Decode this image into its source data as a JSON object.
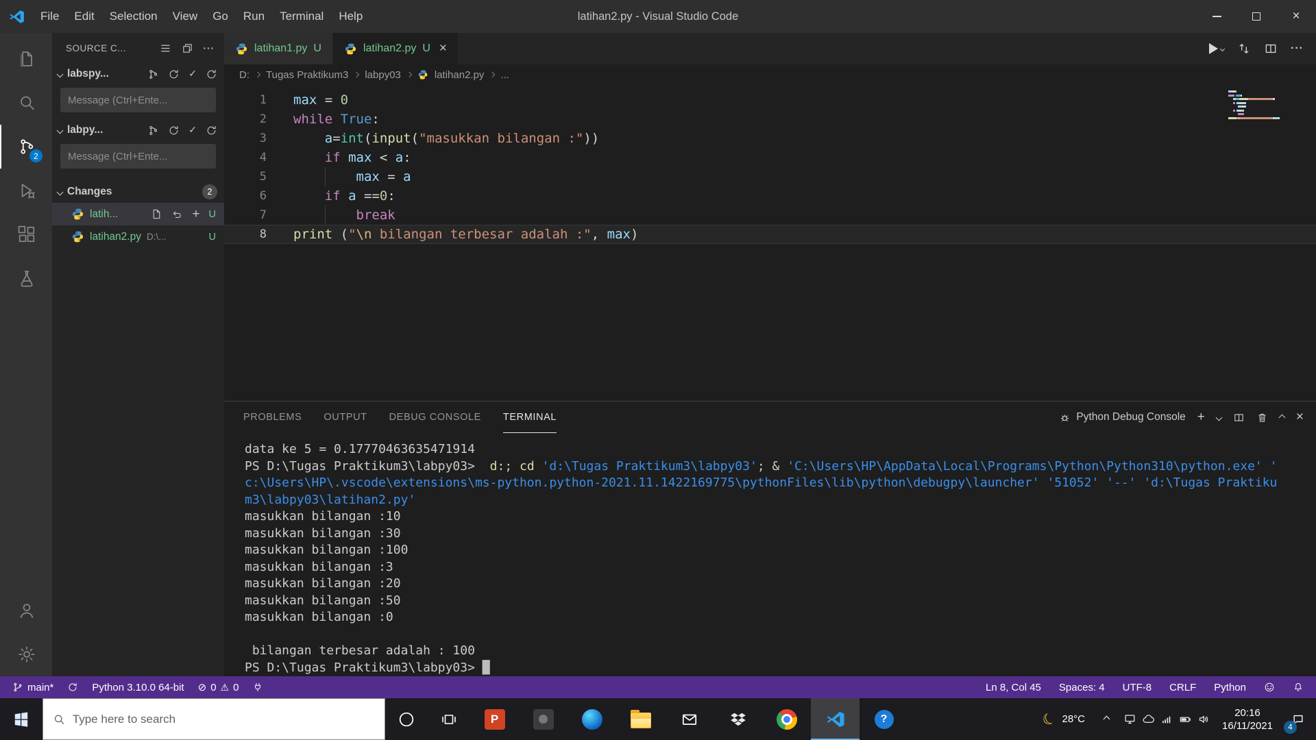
{
  "colors": {
    "accent": "#007acc",
    "statusbar_bg": "#532d8c",
    "badge_blue": "#007acc",
    "untracked_green": "#73c991",
    "tok_var": "#9cdcfe",
    "tok_kw": "#c586c0",
    "tok_const": "#569cd6",
    "tok_num": "#b5cea8",
    "tok_str": "#ce9178",
    "tok_esc": "#d7ba7d",
    "tok_fn": "#dcdcaa",
    "tok_cls": "#4ec9b0",
    "tok_fg": "#d4d4d4",
    "term_fg": "#cccccc",
    "term_cmd": "#dcdcaa",
    "term_str": "#3b8eea"
  },
  "titlebar": {
    "title": "latihan2.py - Visual Studio Code",
    "menus": [
      "File",
      "Edit",
      "Selection",
      "View",
      "Go",
      "Run",
      "Terminal",
      "Help"
    ]
  },
  "activity_bar": {
    "scm_badge": "2"
  },
  "sidebar": {
    "title": "SOURCE C...",
    "repos": [
      {
        "name": "labspy...",
        "message_placeholder": "Message (Ctrl+Ente..."
      },
      {
        "name": "labpy...",
        "message_placeholder": "Message (Ctrl+Ente..."
      }
    ],
    "changes_label": "Changes",
    "changes_badge": "2",
    "files": [
      {
        "name": "latih...",
        "status": "U"
      },
      {
        "name": "latihan2.py",
        "path": "D:\\...",
        "status": "U"
      }
    ]
  },
  "tabs": [
    {
      "label": "latihan1.py",
      "badge": "U"
    },
    {
      "label": "latihan2.py",
      "badge": "U"
    }
  ],
  "breadcrumb": [
    "D:",
    "Tugas Praktikum3",
    "labpy03",
    "latihan2.py",
    "..."
  ],
  "editor": {
    "lines": [
      {
        "num": "1",
        "tokens": [
          [
            "max",
            "var"
          ],
          [
            " = ",
            "fg"
          ],
          [
            "0",
            "num"
          ]
        ]
      },
      {
        "num": "2",
        "tokens": [
          [
            "while",
            "kw"
          ],
          [
            " ",
            "fg"
          ],
          [
            "True",
            "const"
          ],
          [
            ":",
            "fg"
          ]
        ]
      },
      {
        "num": "3",
        "tokens": [
          [
            "    ",
            "fg"
          ],
          [
            "a",
            "var"
          ],
          [
            "=",
            "fg"
          ],
          [
            "int",
            "cls"
          ],
          [
            "(",
            "fg"
          ],
          [
            "input",
            "fn"
          ],
          [
            "(",
            "fg"
          ],
          [
            "\"masukkan bilangan :\"",
            "str"
          ],
          [
            "))",
            "fg"
          ]
        ]
      },
      {
        "num": "4",
        "tokens": [
          [
            "    ",
            "fg"
          ],
          [
            "if",
            "kw"
          ],
          [
            " ",
            "fg"
          ],
          [
            "max",
            "var"
          ],
          [
            " < ",
            "fg"
          ],
          [
            "a",
            "var"
          ],
          [
            ":",
            "fg"
          ]
        ]
      },
      {
        "num": "5",
        "tokens": [
          [
            "        ",
            "fg"
          ],
          [
            "max",
            "var"
          ],
          [
            " = ",
            "fg"
          ],
          [
            "a",
            "var"
          ]
        ]
      },
      {
        "num": "6",
        "tokens": [
          [
            "    ",
            "fg"
          ],
          [
            "if",
            "kw"
          ],
          [
            " ",
            "fg"
          ],
          [
            "a",
            "var"
          ],
          [
            " ==",
            "fg"
          ],
          [
            "0",
            "num"
          ],
          [
            ":",
            "fg"
          ]
        ]
      },
      {
        "num": "7",
        "tokens": [
          [
            "        ",
            "fg"
          ],
          [
            "break",
            "kw"
          ]
        ]
      },
      {
        "num": "8",
        "current": true,
        "tokens": [
          [
            "print",
            "fn"
          ],
          [
            " (",
            "fg"
          ],
          [
            "\"",
            "str"
          ],
          [
            "\\n",
            "esc"
          ],
          [
            " bilangan terbesar adalah :\"",
            "str"
          ],
          [
            ", ",
            "fg"
          ],
          [
            "max",
            "var"
          ],
          [
            ")",
            "fg"
          ]
        ]
      }
    ]
  },
  "panel": {
    "tabs": [
      "PROBLEMS",
      "OUTPUT",
      "DEBUG CONSOLE",
      "TERMINAL"
    ],
    "active_tab": "TERMINAL",
    "console_label": "Python Debug Console",
    "terminal_lines": [
      [
        [
          "data ke 5 = 0.17770463635471914",
          "fg"
        ]
      ],
      [
        [
          "PS D:\\Tugas Praktikum3\\labpy03>  ",
          "fg"
        ],
        [
          "d:",
          "cmd"
        ],
        [
          "; ",
          "fg"
        ],
        [
          "cd",
          "cmd"
        ],
        [
          " ",
          "fg"
        ],
        [
          "'d:\\Tugas Praktikum3\\labpy03'",
          "str"
        ],
        [
          "; ",
          "fg"
        ],
        [
          "& ",
          "fg"
        ],
        [
          "'C:\\Users\\HP\\AppData\\Local\\Programs\\Python\\Python310\\python.exe'",
          "str"
        ],
        [
          " '",
          "str"
        ]
      ],
      [
        [
          "c:\\Users\\HP\\.vscode\\extensions\\ms-python.python-2021.11.1422169775\\pythonFiles\\lib\\python\\debugpy\\launcher'",
          "str"
        ],
        [
          " ",
          "fg"
        ],
        [
          "'51052'",
          "str"
        ],
        [
          " ",
          "fg"
        ],
        [
          "'--'",
          "str"
        ],
        [
          " ",
          "fg"
        ],
        [
          "'d:\\Tugas Praktiku",
          "str"
        ]
      ],
      [
        [
          "m3\\labpy03\\latihan2.py'",
          "str"
        ]
      ],
      [
        [
          "masukkan bilangan :10",
          "fg"
        ]
      ],
      [
        [
          "masukkan bilangan :30",
          "fg"
        ]
      ],
      [
        [
          "masukkan bilangan :100",
          "fg"
        ]
      ],
      [
        [
          "masukkan bilangan :3",
          "fg"
        ]
      ],
      [
        [
          "masukkan bilangan :20",
          "fg"
        ]
      ],
      [
        [
          "masukkan bilangan :50",
          "fg"
        ]
      ],
      [
        [
          "masukkan bilangan :0",
          "fg"
        ]
      ],
      [
        [
          " ",
          "fg"
        ]
      ],
      [
        [
          " bilangan terbesar adalah : 100",
          "fg"
        ]
      ],
      [
        [
          "PS D:\\Tugas Praktikum3\\labpy03> ",
          "fg"
        ],
        [
          "█",
          "cursor"
        ]
      ]
    ]
  },
  "statusbar": {
    "branch": "main*",
    "interpreter": "Python 3.10.0 64-bit",
    "errors": "0",
    "warnings": "0",
    "cursor": "Ln 8, Col 45",
    "indent": "Spaces: 4",
    "encoding": "UTF-8",
    "eol": "CRLF",
    "language": "Python"
  },
  "taskbar": {
    "search_placeholder": "Type here to search",
    "temperature": "28°C",
    "time": "20:16",
    "date": "16/11/2021",
    "notification_count": "4"
  }
}
